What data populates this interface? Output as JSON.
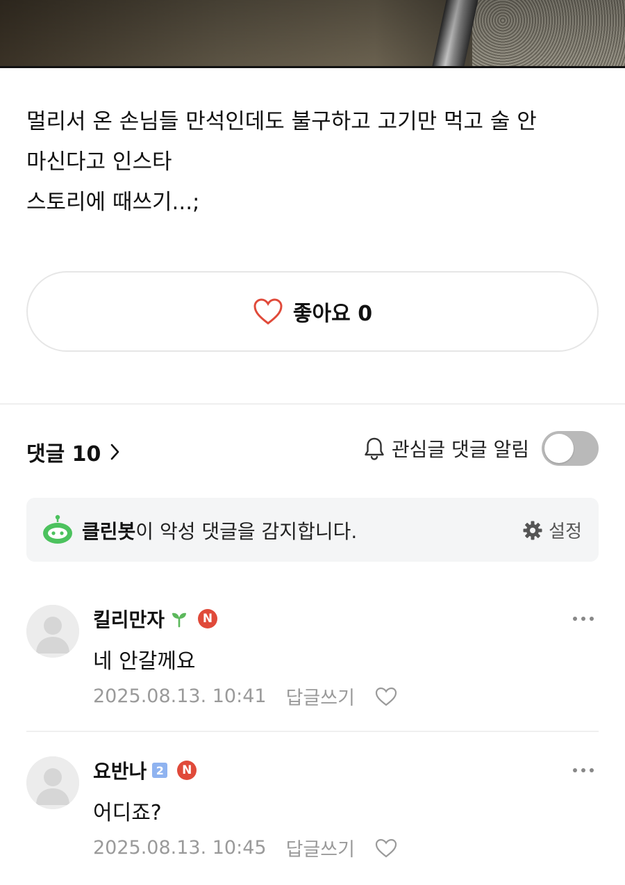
{
  "post": {
    "body_lines": [
      "멀리서 온 손님들 만석인데도 불구하고 고기만 먹고 술 안",
      "마신다고 인스타",
      "스토리에 때쓰기...;"
    ]
  },
  "like": {
    "label": "좋아요",
    "count": "0"
  },
  "comments_header": {
    "label": "댓글",
    "count": "10",
    "notify_label": "관심글 댓글 알림",
    "notify_on": false
  },
  "cleanbot": {
    "name": "클린봇",
    "message": "이 악성 댓글을 감지합니다.",
    "settings_label": "설정",
    "accent_color": "#4cc25e"
  },
  "comments": [
    {
      "author": "킬리만자",
      "badge": "sprout-icon",
      "text": "네 안갈께요",
      "timestamp": "2025.08.13. 10:41",
      "reply_label": "답글쓰기"
    },
    {
      "author": "요반나",
      "badge": "2",
      "text": "어디죠?",
      "timestamp": "2025.08.13. 10:45",
      "reply_label": "답글쓰기"
    }
  ],
  "n_badge": "N"
}
